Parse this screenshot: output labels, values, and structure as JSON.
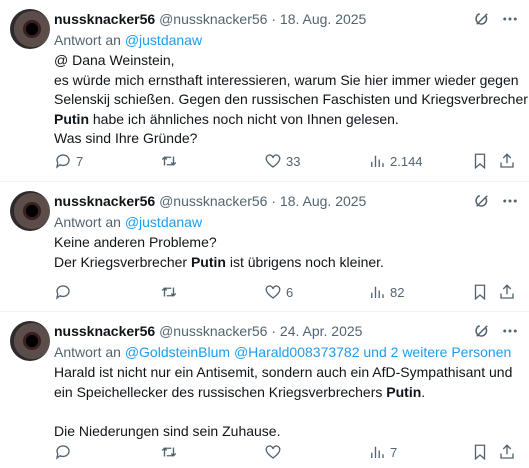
{
  "tweets": [
    {
      "display_name": "nussknacker56",
      "handle": "@nussknacker56",
      "date": "18. Aug. 2025",
      "reply_prefix": "Antwort an",
      "reply_to": "@justdanaw",
      "lines": [
        "@ Dana Weinstein,",
        "es würde mich ernsthaft interessieren, warum Sie hier immer wieder gegen",
        "Selenskij schießen. Gegen den russischen Faschisten und Kriegsverbrecher",
        {
          "bold": "Putin",
          "rest": " habe ich ähnliches noch nicht von Ihnen gelesen."
        },
        "Was sind Ihre Gründe?"
      ],
      "replies": "7",
      "reposts": "",
      "likes": "33",
      "views": "2.144"
    },
    {
      "display_name": "nussknacker56",
      "handle": "@nussknacker56",
      "date": "18. Aug. 2025",
      "reply_prefix": "Antwort an",
      "reply_to": "@justdanaw",
      "line1": "Keine anderen Probleme?",
      "line2_pre": "Der Kriegsverbrecher ",
      "line2_bold": "Putin",
      "line2_post": " ist übrigens noch kleiner.",
      "replies": "",
      "reposts": "",
      "likes": "6",
      "views": "82"
    },
    {
      "display_name": "nussknacker56",
      "handle": "@nussknacker56",
      "date": "24. Apr. 2025",
      "reply_prefix": "Antwort an",
      "reply_to": "@GoldsteinBlum @Harald008373782 und 2 weitere Personen",
      "line1": "Harald ist nicht nur ein Antisemit, sondern auch ein AfD-Sympathisant und",
      "line2_pre": "ein Speichellecker des russischen Kriegsverbrechers ",
      "line2_bold": "Putin",
      "line2_post": ".",
      "line3": "Die Niederungen sind sein Zuhause.",
      "replies": "",
      "reposts": "",
      "likes": "",
      "views": "7"
    }
  ],
  "separator": " · ",
  "icons": [
    "avatar",
    "grok-icon",
    "more-icon",
    "reply-icon",
    "repost-icon",
    "like-icon",
    "views-icon",
    "bookmark-icon",
    "share-icon"
  ]
}
